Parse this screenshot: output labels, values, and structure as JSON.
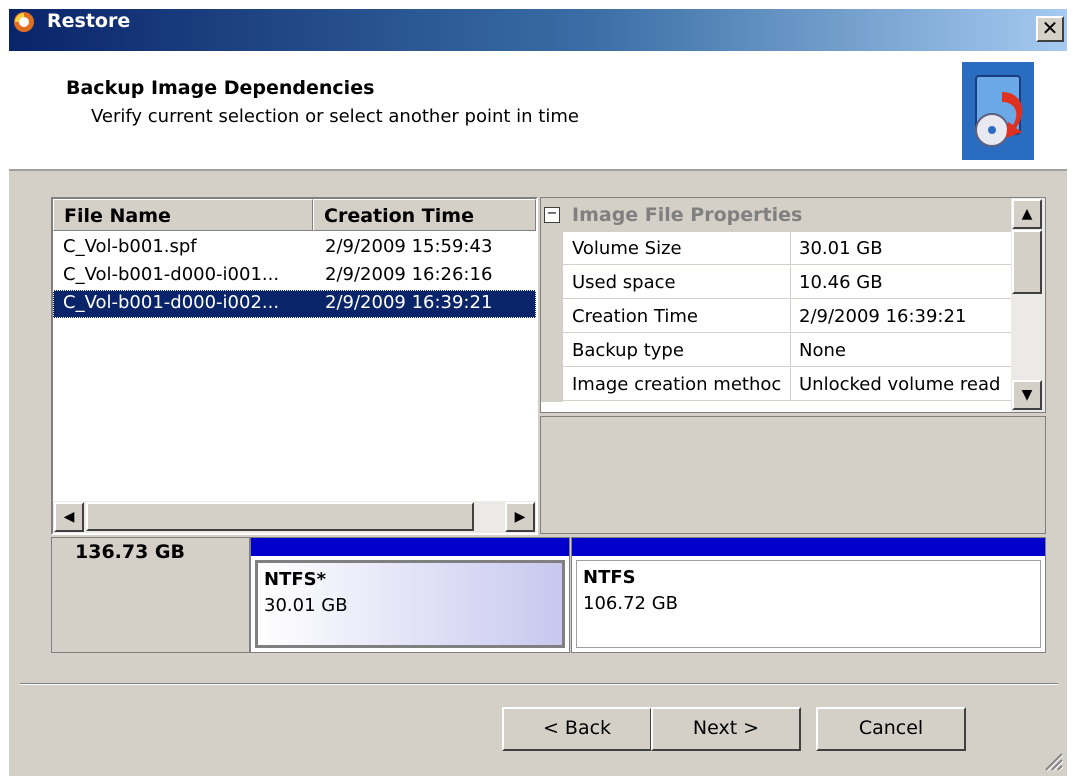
{
  "window": {
    "title": "Restore"
  },
  "header": {
    "title": "Backup Image Dependencies",
    "subtitle": "Verify current selection or select another point in time"
  },
  "file_list": {
    "columns": [
      "File Name",
      "Creation Time"
    ],
    "rows": [
      {
        "name": "C_Vol-b001.spf",
        "time": "2/9/2009 15:59:43",
        "selected": false
      },
      {
        "name": "C_Vol-b001-d000-i001...",
        "time": "2/9/2009 16:26:16",
        "selected": false
      },
      {
        "name": "C_Vol-b001-d000-i002...",
        "time": "2/9/2009 16:39:21",
        "selected": true
      }
    ]
  },
  "properties": {
    "category": "Image File Properties",
    "rows": [
      {
        "name": "Volume Size",
        "value": "30.01 GB"
      },
      {
        "name": "Used space",
        "value": "10.46 GB"
      },
      {
        "name": "Creation Time",
        "value": "2/9/2009 16:39:21"
      },
      {
        "name": "Backup type",
        "value": "None"
      },
      {
        "name": "Image creation methoc",
        "value": "Unlocked volume read"
      }
    ]
  },
  "disk": {
    "size": "136.73 GB",
    "partitions": [
      {
        "name": "NTFS*",
        "size": "30.01 GB",
        "selected": true
      },
      {
        "name": "NTFS",
        "size": "106.72 GB",
        "selected": false
      }
    ]
  },
  "buttons": {
    "back": "< Back",
    "next": "Next >",
    "cancel": "Cancel"
  },
  "colors": {
    "titlebar_start": "#0a246a",
    "selection": "#0a246a",
    "partition_bar": "#0000cc"
  }
}
